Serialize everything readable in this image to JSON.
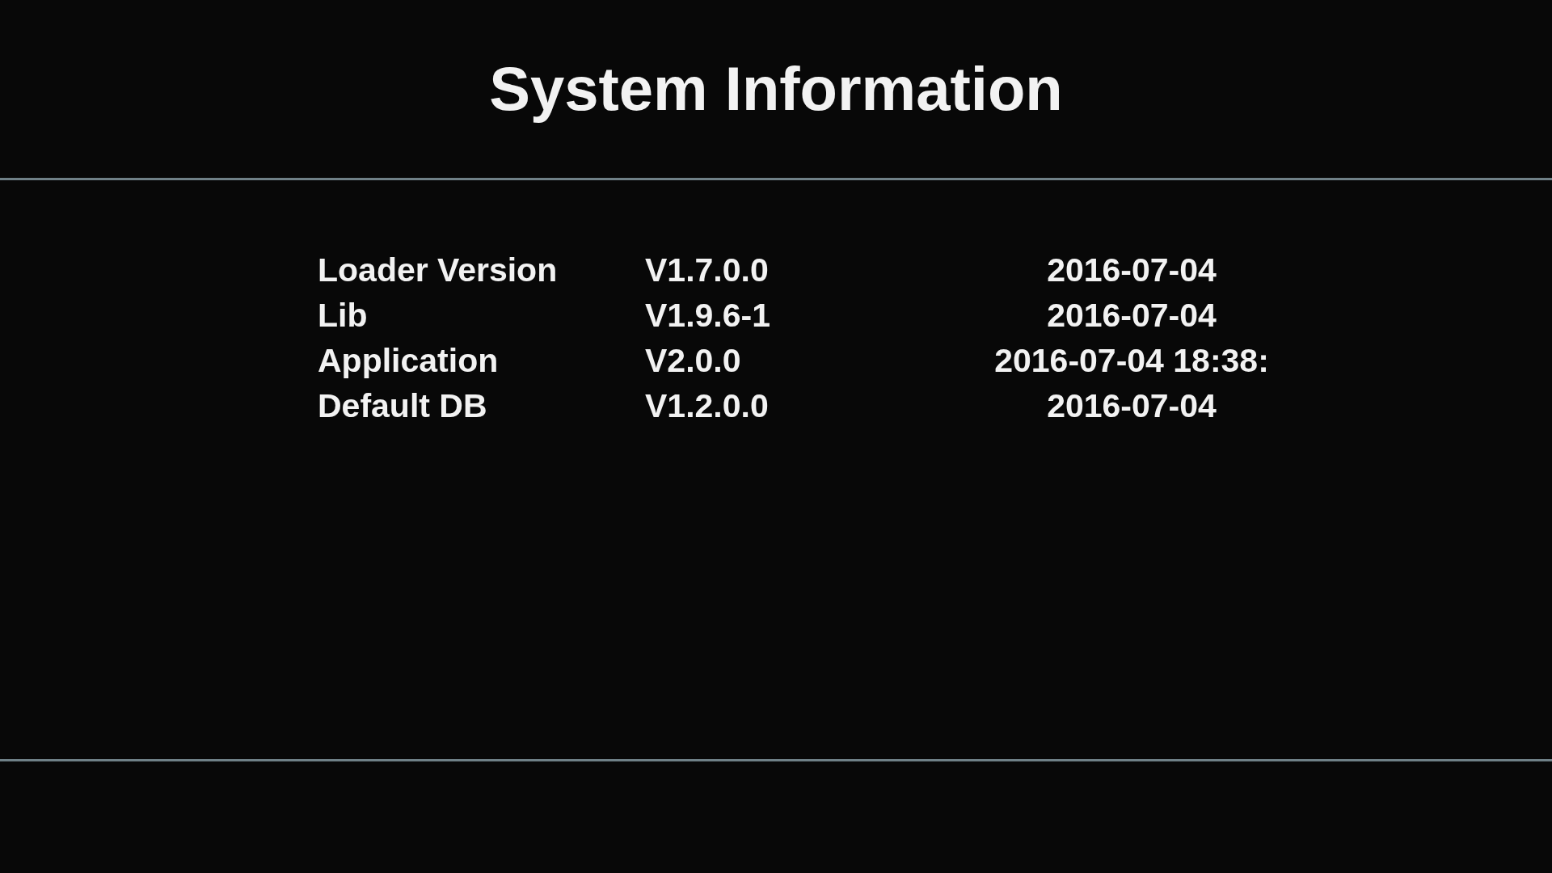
{
  "title": "System Information",
  "rows": [
    {
      "name": "Loader Version",
      "version": "V1.7.0.0",
      "date": "2016-07-04"
    },
    {
      "name": "Lib",
      "version": "V1.9.6-1",
      "date": "2016-07-04"
    },
    {
      "name": "Application",
      "version": "V2.0.0",
      "date": "2016-07-04 18:38:"
    },
    {
      "name": "Default DB",
      "version": "V1.2.0.0",
      "date": "2016-07-04"
    }
  ]
}
